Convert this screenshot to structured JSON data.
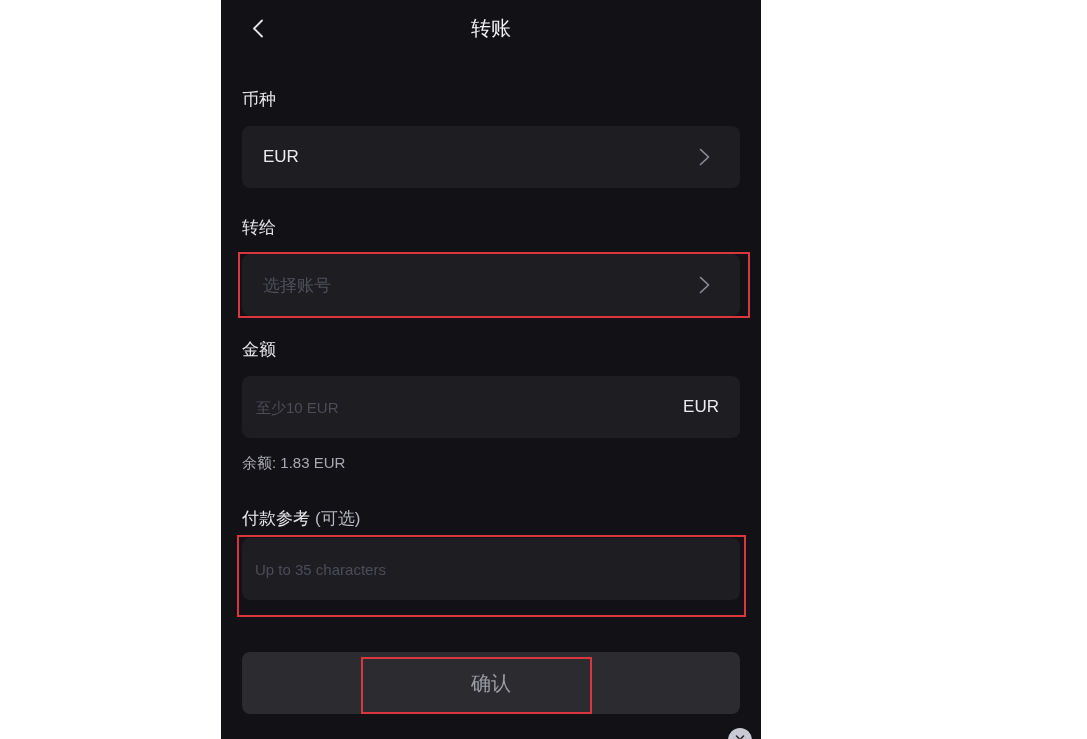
{
  "header": {
    "title": "转账"
  },
  "fields": [
    {
      "kind": "select",
      "label": "币种",
      "value": "EUR",
      "highlighted": false
    },
    {
      "kind": "select",
      "label": "转给",
      "placeholder": "选择账号",
      "highlighted": true
    },
    {
      "kind": "amount",
      "label": "金额",
      "placeholder": "至少10 EUR",
      "suffix": "EUR",
      "note": "余额: 1.83 EUR",
      "highlighted": false
    },
    {
      "kind": "text",
      "label": "付款参考",
      "label_note": "(可选)",
      "placeholder": "Up to 35 characters",
      "highlighted": true
    }
  ],
  "confirm_button": {
    "label": "确认",
    "disabled": true,
    "highlighted": true
  }
}
